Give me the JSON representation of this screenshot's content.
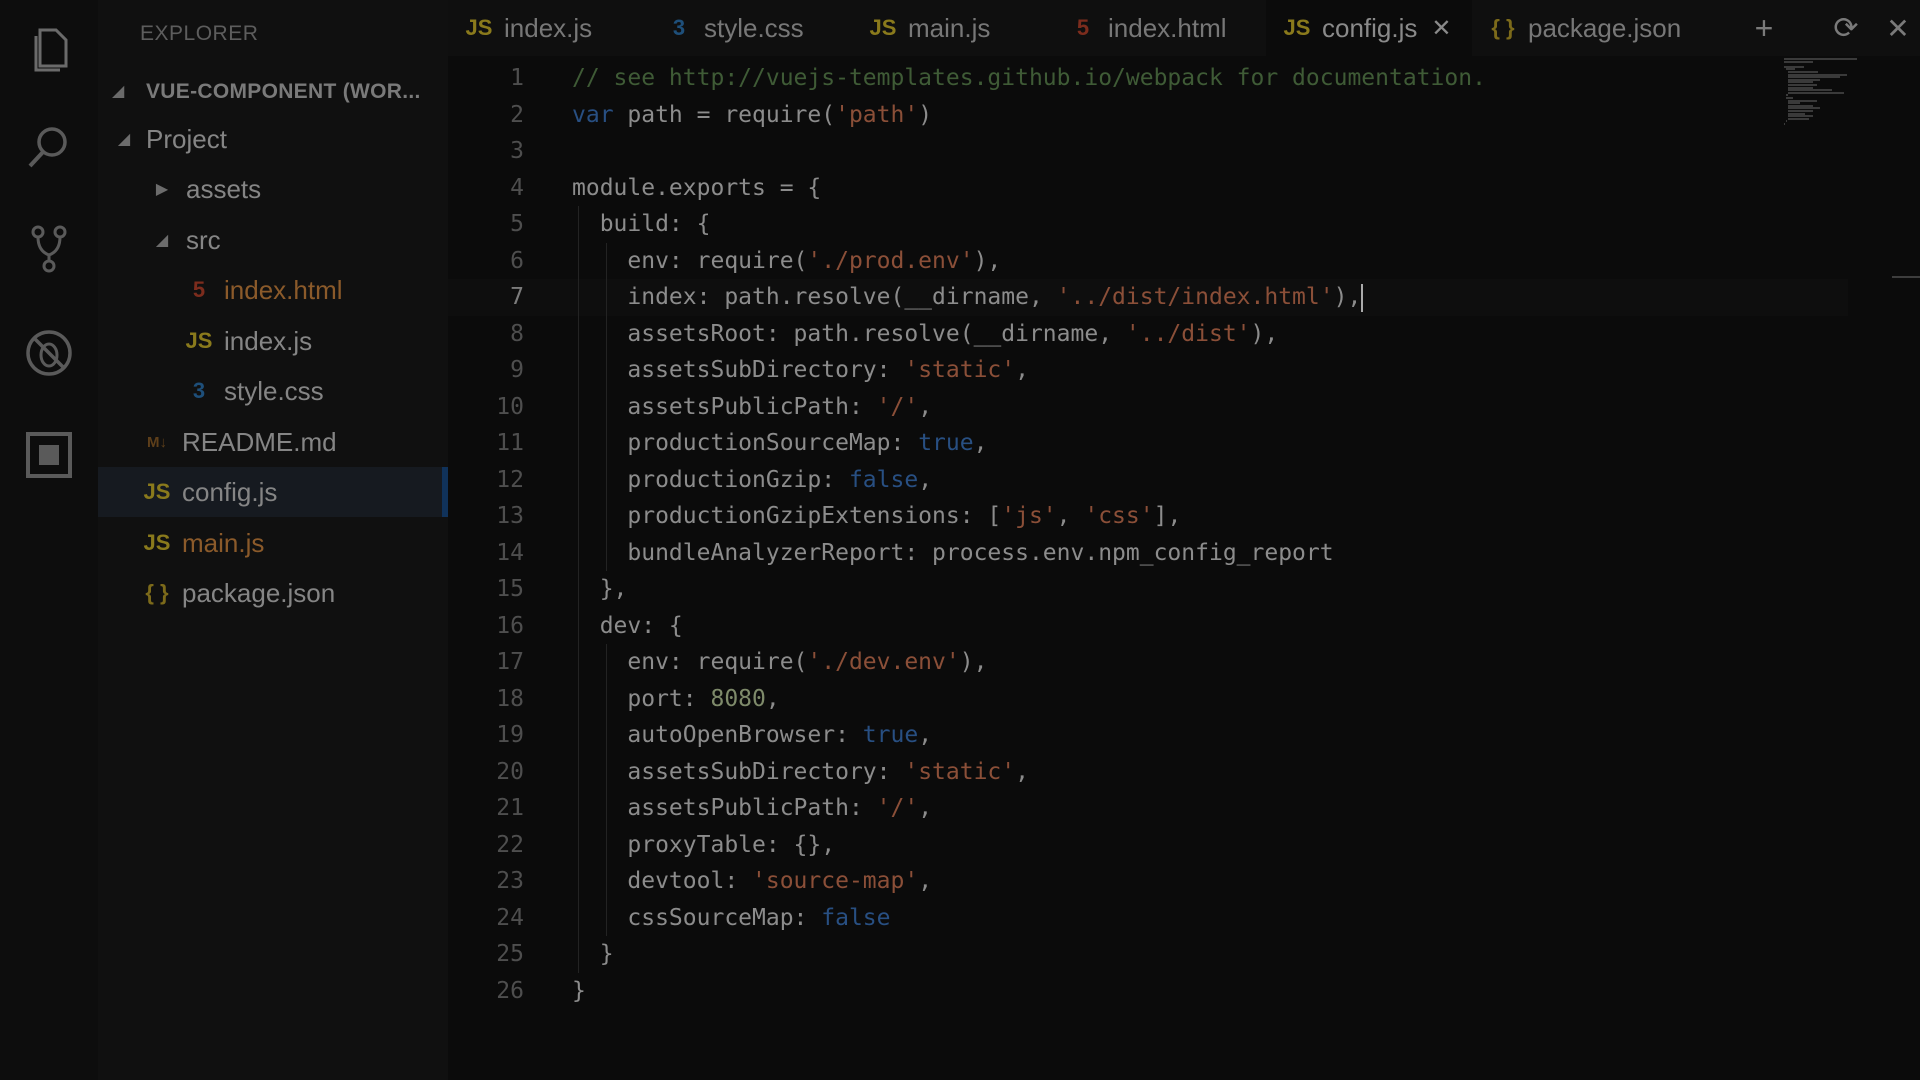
{
  "colors": {
    "background": "#0b0b0b",
    "sidebar": "#101010",
    "activity_bar": "#0d0d0d",
    "selection_accent": "#10325a",
    "js_icon": "#8a7a1c",
    "css_icon": "#1e4f7a",
    "html_icon": "#7c2c1d",
    "string": "#8b4f38",
    "keyword": "#284f82",
    "comment": "#3f5b36"
  },
  "activity_bar": {
    "items": [
      {
        "name": "files-icon"
      },
      {
        "name": "search-icon"
      },
      {
        "name": "source-control-icon"
      },
      {
        "name": "debug-icon"
      },
      {
        "name": "extensions-icon"
      }
    ]
  },
  "sidebar": {
    "title": "EXPLORER",
    "workspace": "VUE-COMPONENT (WOR...",
    "tree": [
      {
        "label": "Project",
        "icon": "",
        "arrow": "◢",
        "type": "folder"
      },
      {
        "label": "assets",
        "icon": "",
        "arrow": "▶",
        "type": "folder"
      },
      {
        "label": "src",
        "icon": "",
        "arrow": "◢",
        "type": "folder"
      },
      {
        "label": "index.html",
        "icon": "5",
        "type": "html"
      },
      {
        "label": "index.js",
        "icon": "JS",
        "type": "js"
      },
      {
        "label": "style.css",
        "icon": "3",
        "type": "css"
      },
      {
        "label": "README.md",
        "icon": "M↓",
        "type": "md"
      },
      {
        "label": "config.js",
        "icon": "JS",
        "type": "js"
      },
      {
        "label": "main.js",
        "icon": "JS",
        "type": "js"
      },
      {
        "label": "package.json",
        "icon": "{ }",
        "type": "json"
      }
    ]
  },
  "tabs": [
    {
      "label": "index.js",
      "icon": "JS",
      "type": "js"
    },
    {
      "label": "style.css",
      "icon": "3",
      "type": "css"
    },
    {
      "label": "main.js",
      "icon": "JS",
      "type": "js"
    },
    {
      "label": "index.html",
      "icon": "5",
      "type": "html"
    },
    {
      "label": "config.js",
      "icon": "JS",
      "type": "js",
      "close": "✕"
    },
    {
      "label": "package.json",
      "icon": "{ }",
      "type": "json"
    }
  ],
  "tab_actions": [
    {
      "name": "new-file-icon",
      "glyph": "+"
    },
    {
      "name": "refresh-icon",
      "glyph": "⟳"
    },
    {
      "name": "close-icon",
      "glyph": "✕"
    }
  ],
  "editor": {
    "current_line": 7,
    "lines": [
      "// see http://vuejs-templates.github.io/webpack for documentation.",
      "var path = require('path')",
      "",
      "module.exports = {",
      "  build: {",
      "    env: require('./prod.env'),",
      "    index: path.resolve(__dirname, '../dist/index.html'),",
      "    assetsRoot: path.resolve(__dirname, '../dist'),",
      "    assetsSubDirectory: 'static',",
      "    assetsPublicPath: '/',",
      "    productionSourceMap: true,",
      "    productionGzip: false,",
      "    productionGzipExtensions: ['js', 'css'],",
      "    bundleAnalyzerReport: process.env.npm_config_report",
      "  },",
      "  dev: {",
      "    env: require('./dev.env'),",
      "    port: 8080,",
      "    autoOpenBrowser: true,",
      "    assetsSubDirectory: 'static',",
      "    assetsPublicPath: '/',",
      "    proxyTable: {},",
      "    devtool: 'source-map',",
      "    cssSourceMap: false",
      "  }",
      "}"
    ]
  }
}
